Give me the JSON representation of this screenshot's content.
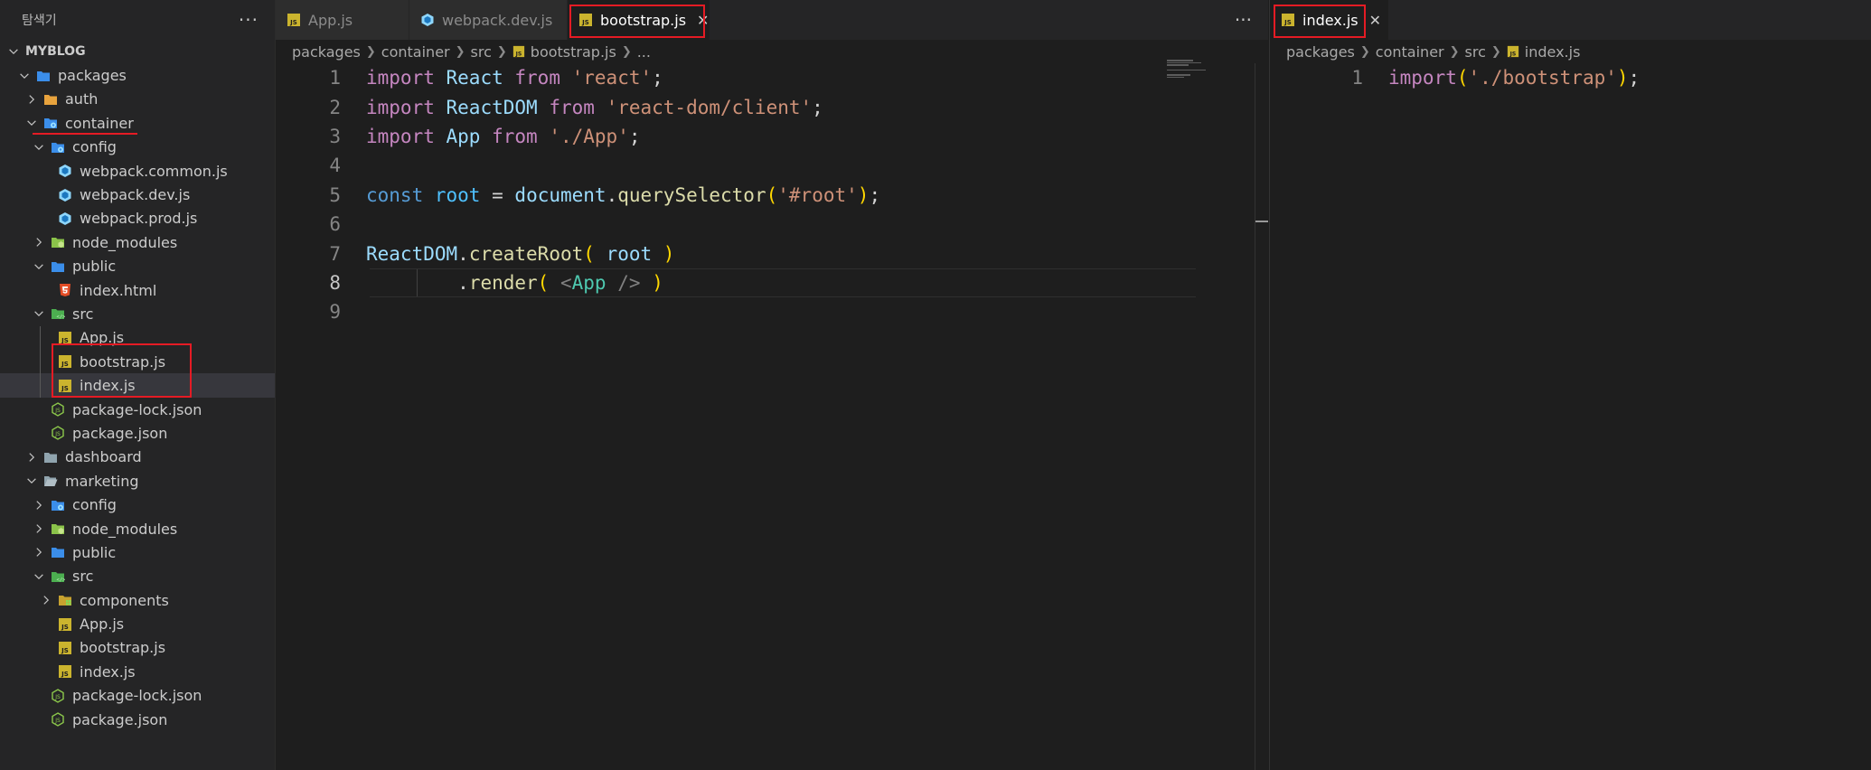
{
  "sidebar": {
    "title": "탐색기",
    "more_label": "···",
    "tree": [
      {
        "label": "MYBLOG",
        "depth": 0,
        "kind": "root",
        "open": true
      },
      {
        "label": "packages",
        "depth": 1,
        "kind": "folder-blue",
        "open": true
      },
      {
        "label": "auth",
        "depth": 2,
        "kind": "folder-yellow",
        "open": false
      },
      {
        "label": "container",
        "depth": 2,
        "kind": "folder-blue-gear",
        "open": true
      },
      {
        "label": "config",
        "depth": 3,
        "kind": "folder-blue-gear",
        "open": true
      },
      {
        "label": "webpack.common.js",
        "depth": 4,
        "kind": "webpack"
      },
      {
        "label": "webpack.dev.js",
        "depth": 4,
        "kind": "webpack"
      },
      {
        "label": "webpack.prod.js",
        "depth": 4,
        "kind": "webpack"
      },
      {
        "label": "node_modules",
        "depth": 3,
        "kind": "folder-green",
        "open": false
      },
      {
        "label": "public",
        "depth": 3,
        "kind": "folder-blue",
        "open": true
      },
      {
        "label": "index.html",
        "depth": 4,
        "kind": "html"
      },
      {
        "label": "src",
        "depth": 3,
        "kind": "folder-green-src",
        "open": true
      },
      {
        "label": "App.js",
        "depth": 4,
        "kind": "js"
      },
      {
        "label": "bootstrap.js",
        "depth": 4,
        "kind": "js"
      },
      {
        "label": "index.js",
        "depth": 4,
        "kind": "js",
        "selected": true
      },
      {
        "label": "package-lock.json",
        "depth": 3,
        "kind": "node"
      },
      {
        "label": "package.json",
        "depth": 3,
        "kind": "node"
      },
      {
        "label": "dashboard",
        "depth": 2,
        "kind": "folder-gray",
        "open": false
      },
      {
        "label": "marketing",
        "depth": 2,
        "kind": "folder-gray-open",
        "open": true
      },
      {
        "label": "config",
        "depth": 3,
        "kind": "folder-blue-gear",
        "open": false
      },
      {
        "label": "node_modules",
        "depth": 3,
        "kind": "folder-green",
        "open": false
      },
      {
        "label": "public",
        "depth": 3,
        "kind": "folder-blue",
        "open": false
      },
      {
        "label": "src",
        "depth": 3,
        "kind": "folder-green-src",
        "open": true
      },
      {
        "label": "components",
        "depth": 4,
        "kind": "folder-yellow-comp",
        "open": false
      },
      {
        "label": "App.js",
        "depth": 4,
        "kind": "js"
      },
      {
        "label": "bootstrap.js",
        "depth": 4,
        "kind": "js"
      },
      {
        "label": "index.js",
        "depth": 4,
        "kind": "js"
      },
      {
        "label": "package-lock.json",
        "depth": 3,
        "kind": "node"
      },
      {
        "label": "package.json",
        "depth": 3,
        "kind": "node"
      }
    ]
  },
  "editor_left": {
    "tabs": [
      {
        "label": "App.js",
        "icon": "js",
        "active": false
      },
      {
        "label": "webpack.dev.js",
        "icon": "webpack",
        "active": false
      },
      {
        "label": "bootstrap.js",
        "icon": "js",
        "active": true,
        "close": "✕"
      }
    ],
    "more_label": "···",
    "breadcrumb": [
      "packages",
      "container",
      "src",
      "bootstrap.js",
      "..."
    ],
    "line_numbers": [
      "1",
      "2",
      "3",
      "4",
      "5",
      "6",
      "7",
      "8",
      "9"
    ],
    "code_lines": [
      "import React from 'react';",
      "import ReactDOM from 'react-dom/client';",
      "import App from './App';",
      "",
      "const root = document.querySelector('#root');",
      "",
      "ReactDOM.createRoot( root )",
      "        .render( <App /> )",
      ""
    ]
  },
  "editor_right": {
    "tabs": [
      {
        "label": "index.js",
        "icon": "js",
        "active": true,
        "close": "✕"
      }
    ],
    "breadcrumb": [
      "packages",
      "container",
      "src",
      "index.js"
    ],
    "line_numbers": [
      "1"
    ],
    "code_lines": [
      "import('./bootstrap');"
    ]
  },
  "colors": {
    "highlight_red": "#e51b24",
    "keyword": "#c586c0",
    "string": "#ce9178",
    "variable": "#9cdcfe",
    "function": "#dcdcaa"
  }
}
